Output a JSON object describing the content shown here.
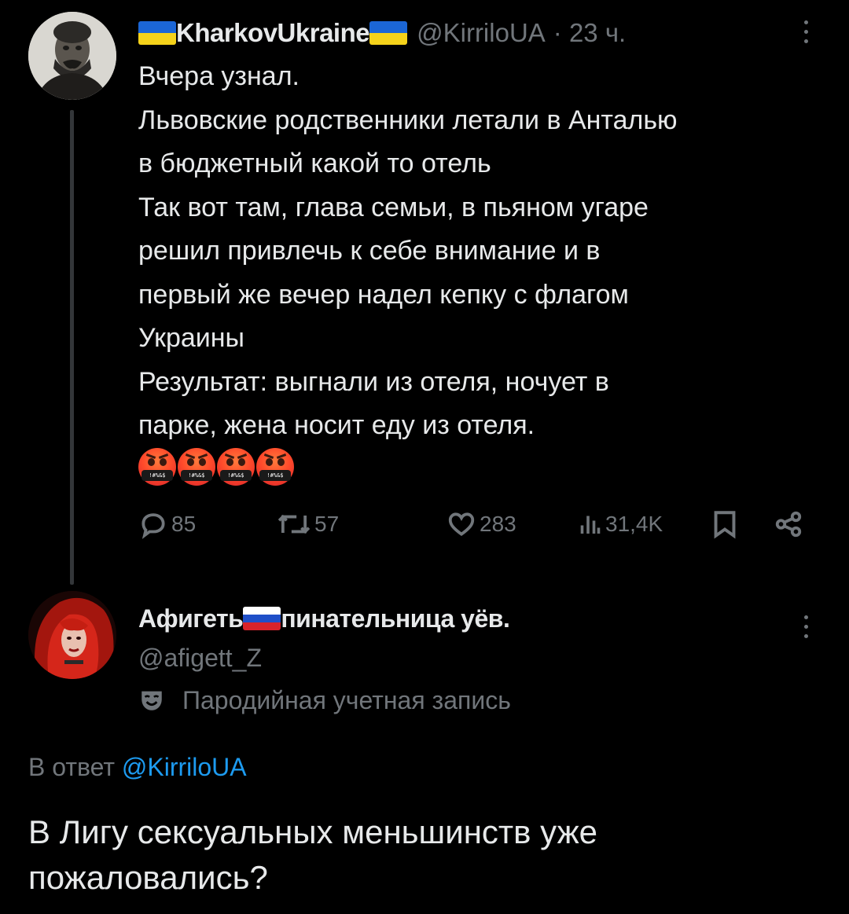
{
  "colors": {
    "background": "#000000",
    "text_primary": "#e7e9ea",
    "text_secondary": "#71767b",
    "link": "#1d9bf0",
    "thread_line": "#333639"
  },
  "tweet": {
    "author_name": "KharkovUkraine",
    "name_flags": [
      "ukraine-flag",
      "ukraine-flag"
    ],
    "handle": "@KirriloUA",
    "time": "· 23 ч.",
    "body_lines": [
      "Вчера узнал.",
      "Львовские родственники летали в Анталью",
      "в бюджетный какой то отель",
      "Так вот там, глава семьи, в пьяном угаре",
      "решил привлечь к себе внимание и в",
      "первый же вечер надел кепку с  флагом",
      "Украины",
      "Результат: выгнали из отеля, ночует в",
      "парке, жена носит еду из отеля."
    ],
    "emojis": [
      "face-with-symbols-on-mouth",
      "face-with-symbols-on-mouth",
      "face-with-symbols-on-mouth",
      "face-with-symbols-on-mouth"
    ],
    "emoji_mouth_text": "!#%&$",
    "actions": {
      "replies": "85",
      "retweets": "57",
      "likes": "283",
      "views": "31,4K"
    }
  },
  "reply": {
    "name_before_flag": "Афигеть",
    "name_flag": "russia-flag",
    "name_after_flag": "пинательница уёв.",
    "handle": "@afigett_Z",
    "parody_label": "Пародийная учетная запись",
    "reply_to_prefix": "В ответ",
    "reply_to_mention": "@KirriloUA",
    "body_lines": [
      "В Лигу сексуальных меньшинств уже",
      "пожаловались?"
    ]
  }
}
